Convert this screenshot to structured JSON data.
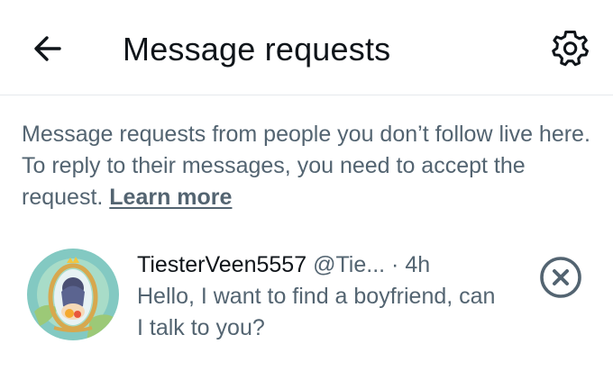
{
  "header": {
    "title": "Message requests",
    "back_icon": "back-arrow-icon",
    "settings_icon": "gear-icon"
  },
  "notice": {
    "text": "Message requests from people you don’t follow live here. To reply to their messages, you need to accept the request. ",
    "link_label": "Learn more"
  },
  "requests": [
    {
      "display_name": "TiesterVeen5557",
      "handle": "@Tie...",
      "separator": "·",
      "time": "4h",
      "message": "Hello, I want to find a boyfriend, can I talk to you?",
      "dismiss_icon": "close-circle-icon"
    }
  ],
  "colors": {
    "text_primary": "#0f1419",
    "text_secondary": "#536471",
    "divider": "#e6e9ec",
    "background": "#ffffff"
  }
}
